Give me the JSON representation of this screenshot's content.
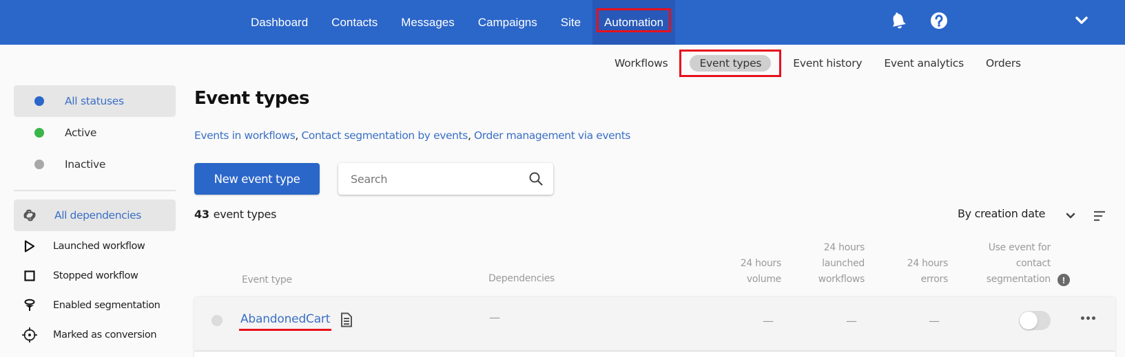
{
  "topnav": {
    "items": [
      {
        "label": "Dashboard",
        "active": false
      },
      {
        "label": "Contacts",
        "active": false
      },
      {
        "label": "Messages",
        "active": false
      },
      {
        "label": "Campaigns",
        "active": false
      },
      {
        "label": "Site",
        "active": false
      },
      {
        "label": "Automation",
        "active": true
      }
    ],
    "icons": [
      "bell-icon",
      "help-icon",
      "chevron-down-icon"
    ]
  },
  "subnav": {
    "items": [
      {
        "label": "Workflows",
        "active": false
      },
      {
        "label": "Event types",
        "active": true
      },
      {
        "label": "Event history",
        "active": false
      },
      {
        "label": "Event analytics",
        "active": false
      },
      {
        "label": "Orders",
        "active": false
      }
    ]
  },
  "sidebar": {
    "statuses": [
      {
        "label": "All statuses",
        "color": "#2b66c9",
        "selected": true
      },
      {
        "label": "Active",
        "color": "#3ab54a",
        "selected": false
      },
      {
        "label": "Inactive",
        "color": "#a8a8a8",
        "selected": false
      }
    ],
    "dependencies": [
      {
        "label": "All dependencies",
        "icon": "link-icon",
        "selected": true
      },
      {
        "label": "Launched workflow",
        "icon": "play-icon",
        "selected": false
      },
      {
        "label": "Stopped workflow",
        "icon": "stop-icon",
        "selected": false
      },
      {
        "label": "Enabled segmentation",
        "icon": "funnel-icon",
        "selected": false
      },
      {
        "label": "Marked as conversion",
        "icon": "target-icon",
        "selected": false
      }
    ]
  },
  "main": {
    "title": "Event types",
    "links": [
      "Events in workflows",
      "Contact segmentation by events",
      "Order management via events"
    ],
    "link_separator": ", ",
    "new_button": "New event type",
    "search": {
      "placeholder": "Search",
      "value": ""
    },
    "count": {
      "number": "43",
      "label": "event types"
    },
    "sort": {
      "label": "By creation date"
    }
  },
  "table": {
    "columns": {
      "event_type": "Event type",
      "dependencies": "Dependencies",
      "volume": [
        "24 hours",
        "volume"
      ],
      "launched": [
        "24 hours",
        "launched",
        "workflows"
      ],
      "errors": [
        "24 hours",
        "errors"
      ],
      "segmentation": [
        "Use event for",
        "contact",
        "segmentation"
      ]
    },
    "rows": [
      {
        "name": "AbandonedCart",
        "status": "inactive",
        "dependencies": "—",
        "volume": "—",
        "launched": "—",
        "errors": "—",
        "segmentation_enabled": false
      }
    ]
  },
  "colors": {
    "brand": "#2b66c9",
    "link": "#3a6fc5",
    "highlight": "#e8101a"
  }
}
